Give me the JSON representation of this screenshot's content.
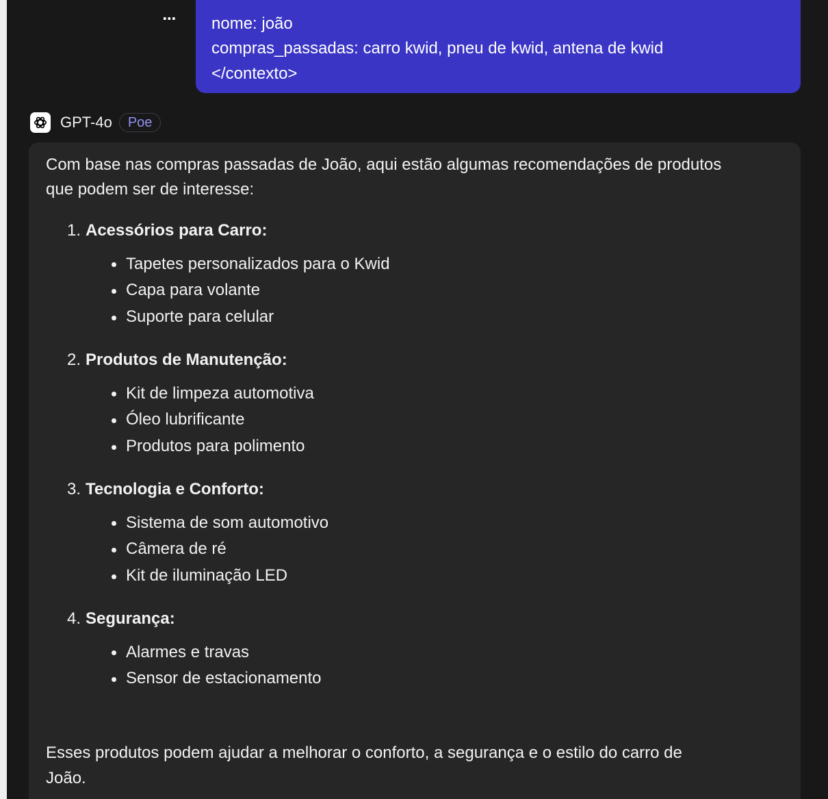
{
  "user_message": {
    "lines": [
      "nome: joão",
      "compras_passadas: carro kwid, pneu de kwid, antena de kwid",
      "</contexto>"
    ],
    "more_label": "⋯"
  },
  "bot": {
    "name": "GPT-4o",
    "badge": "Poe",
    "icon": "openai-logo-icon"
  },
  "response": {
    "intro_line1": "Com base nas compras passadas de João, aqui estão algumas recomendações de produtos",
    "intro_line2": "que podem ser de interesse:",
    "sections": [
      {
        "number": "1.",
        "title": "Acessórios para Carro:",
        "items": [
          "Tapetes personalizados para o Kwid",
          "Capa para volante",
          "Suporte para celular"
        ]
      },
      {
        "number": "2.",
        "title": "Produtos de Manutenção:",
        "items": [
          "Kit de limpeza automotiva",
          "Óleo lubrificante",
          "Produtos para polimento"
        ]
      },
      {
        "number": "3.",
        "title": "Tecnologia e Conforto:",
        "items": [
          "Sistema de som automotivo",
          "Câmera de ré",
          "Kit de iluminação LED"
        ]
      },
      {
        "number": "4.",
        "title": "Segurança:",
        "items": [
          "Alarmes e travas",
          "Sensor de estacionamento"
        ]
      }
    ],
    "outro_line1": "Esses produtos podem ajudar a melhorar o conforto, a segurança e o estilo do carro de",
    "outro_line2": "João."
  },
  "colors": {
    "background": "#181818",
    "user_bubble": "#3a35c4",
    "response_card": "#262626",
    "badge_text": "#8f8ff0"
  }
}
